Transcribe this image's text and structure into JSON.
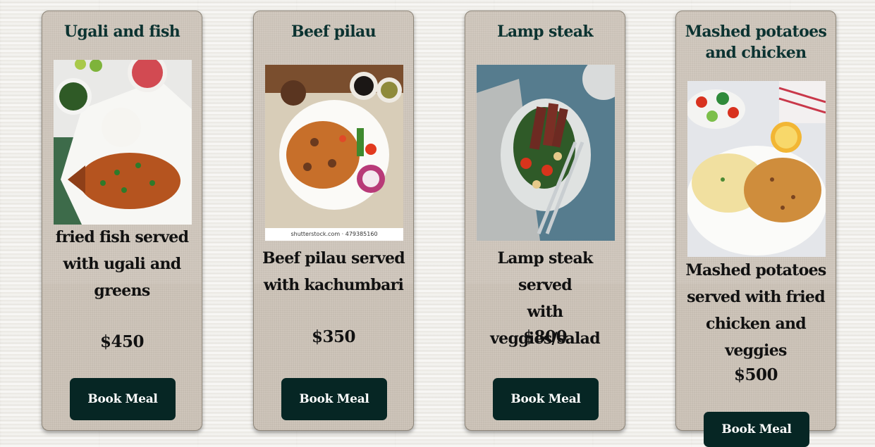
{
  "meals": [
    {
      "title": [
        "Ugali and fish"
      ],
      "image_icon": "fried-fish-with-ugali-photo",
      "description": [
        "fried fish served",
        "with ugali and",
        "greens"
      ],
      "price": "$450",
      "button": "Book Meal"
    },
    {
      "title": [
        "Beef pilau"
      ],
      "image_icon": "beef-pilau-photo",
      "watermark": "shutterstock.com · 479385160",
      "description": [
        "Beef pilau served",
        "with kachumbari"
      ],
      "price": "$350",
      "button": "Book Meal"
    },
    {
      "title": [
        "Lamp steak"
      ],
      "image_icon": "lamb-steak-salad-photo",
      "description": [
        "Lamp steak served",
        "with veggies/salad"
      ],
      "price": "$800",
      "button": "Book Meal"
    },
    {
      "title": [
        "Mashed potatoes",
        "and chicken"
      ],
      "image_icon": "mashed-potatoes-chicken-photo",
      "description": [
        "Mashed potatoes",
        "served with fried",
        "chicken and veggies"
      ],
      "price": "$500",
      "button": "Book Meal"
    }
  ],
  "colors": {
    "title_text": "#0c3331",
    "button_bg": "#062624",
    "card_bg": "#cbc1b5"
  }
}
